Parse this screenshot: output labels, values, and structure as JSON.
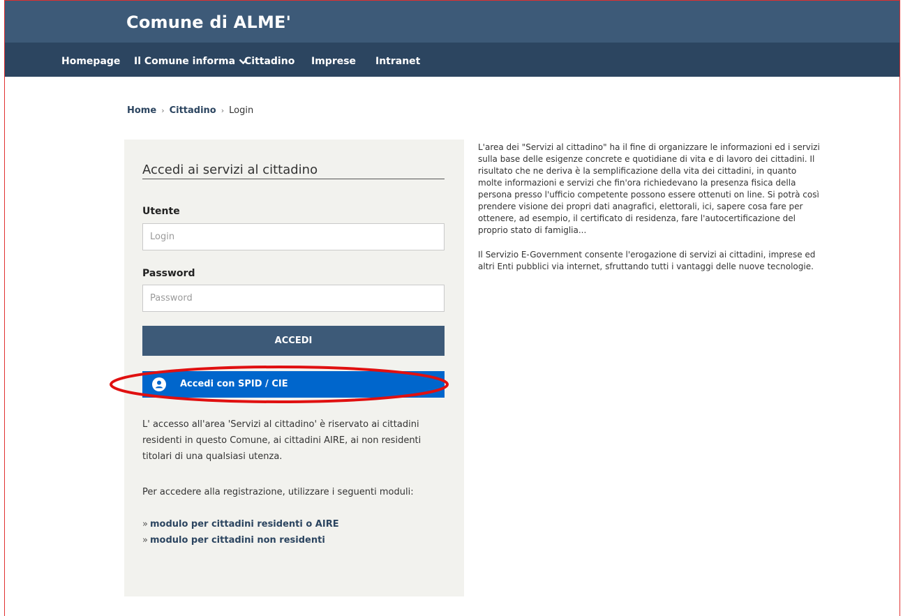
{
  "site": {
    "title": "Comune di ALME'"
  },
  "nav": {
    "items": [
      {
        "label": "Homepage"
      },
      {
        "label": "Il Comune informa"
      },
      {
        "label": "Cittadino"
      },
      {
        "label": "Imprese"
      },
      {
        "label": "Intranet"
      }
    ]
  },
  "breadcrumb": {
    "home": "Home",
    "section": "Cittadino",
    "current": "Login"
  },
  "login": {
    "heading": "Accedi ai servizi al cittadino",
    "user_label": "Utente",
    "user_placeholder": "Login",
    "password_label": "Password",
    "password_placeholder": "Password",
    "submit_label": "ACCEDI",
    "spid_label": "Accedi con SPID / CIE"
  },
  "info": {
    "access_text": "L' accesso all'area 'Servizi al cittadino' è riservato ai cittadini residenti in questo Comune, ai cittadini AIRE, ai non residenti titolari di una qualsiasi utenza.",
    "registration_text": "Per accedere alla registrazione, utilizzare i seguenti moduli:",
    "link_prefix": "»",
    "modules": [
      {
        "label": "modulo per cittadini residenti o AIRE"
      },
      {
        "label": "modulo per cittadini non residenti"
      }
    ]
  },
  "description": {
    "para1": "L'area dei \"Servizi al cittadino\" ha il fine di organizzare le informazioni ed i servizi sulla base delle esigenze concrete e quotidiane di vita e di lavoro dei cittadini. Il risultato che ne deriva è la semplificazione della vita dei cittadini, in quanto molte informazioni e servizi che fin'ora richiedevano la presenza fisica della persona presso l'ufficio competente possono essere ottenuti on line. Si potrà così prendere visione dei propri dati anagrafici, elettorali, ici, sapere cosa fare per ottenere, ad esempio, il certificato di residenza, fare l'autocertificazione del proprio stato di famiglia...",
    "para2": "Il Servizio E-Government consente l'erogazione di servizi ai cittadini, imprese ed altri Enti pubblici via internet, sfruttando tutti i vantaggi delle nuove tecnologie."
  },
  "colors": {
    "header": "#3d5a78",
    "navbar": "#2c4560",
    "spid_button": "#0066cc",
    "panel": "#f2f2ee",
    "highlight": "#e01010"
  }
}
